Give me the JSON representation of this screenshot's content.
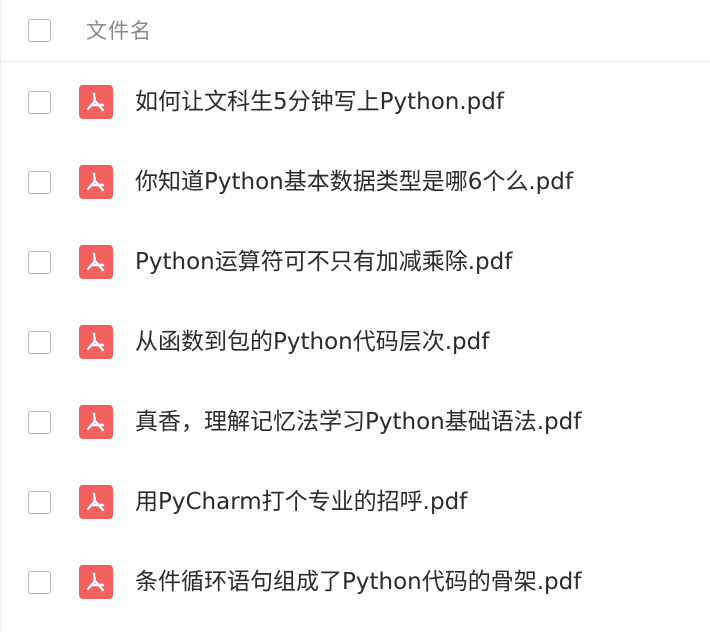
{
  "header": {
    "column_label": "文件名"
  },
  "files": [
    {
      "name": "如何让文科生5分钟写上Python.pdf",
      "icon": "pdf-icon"
    },
    {
      "name": "你知道Python基本数据类型是哪6个么.pdf",
      "icon": "pdf-icon"
    },
    {
      "name": "Python运算符可不只有加减乘除.pdf",
      "icon": "pdf-icon"
    },
    {
      "name": "从函数到包的Python代码层次.pdf",
      "icon": "pdf-icon"
    },
    {
      "name": "真香，理解记忆法学习Python基础语法.pdf",
      "icon": "pdf-icon"
    },
    {
      "name": "用PyCharm打个专业的招呼.pdf",
      "icon": "pdf-icon"
    },
    {
      "name": "条件循环语句组成了Python代码的骨架.pdf",
      "icon": "pdf-icon"
    }
  ],
  "colors": {
    "pdf_icon_bg": "#f26060",
    "checkbox_border": "#b8b8b8",
    "header_text": "#8a8a8a",
    "file_text": "#2b2b2b"
  }
}
